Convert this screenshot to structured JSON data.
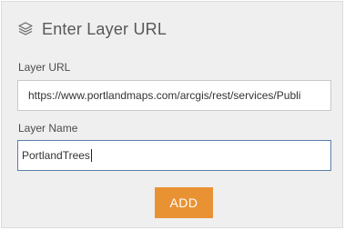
{
  "header": {
    "icon": "layers-icon",
    "title": "Enter Layer URL"
  },
  "form": {
    "url_label": "Layer URL",
    "url_value": "https://www.portlandmaps.com/arcgis/rest/services/Publi",
    "name_label": "Layer Name",
    "name_value": "PortlandTrees",
    "add_label": "ADD"
  },
  "colors": {
    "panel_bg": "#efefef",
    "accent": "#e99234",
    "focus_border": "#5b7fa8"
  }
}
